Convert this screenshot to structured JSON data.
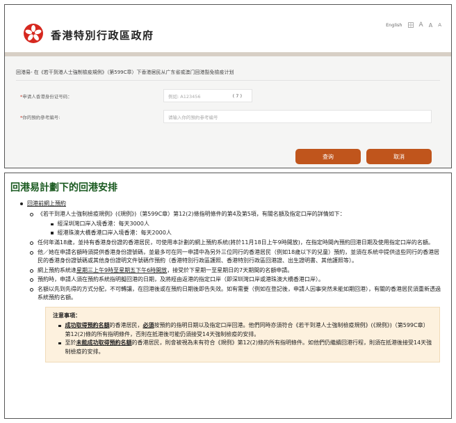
{
  "header": {
    "gov_title": "香港特別行政區政府",
    "lang_link": "English",
    "font_sizes": [
      "A",
      "A",
      "A"
    ]
  },
  "scheme": {
    "title": "回港易- 在《若干到港人士強制檢疫規例》（第599C章）下香港居民从广东省或澳门回港豁免檢疫计划"
  },
  "form": {
    "id_label": "申请人香港身份证号码：",
    "id_placeholder": "例如: A123456",
    "check_digit_placeholder": "( 7 )",
    "ref_label": "你的預約參考編号:",
    "ref_placeholder": "请输入你的預約参考编号",
    "required_mark": "*",
    "search_button": "查询",
    "cancel_button": "取消"
  },
  "arrangement": {
    "heading": "回港易計劃下的回港安排",
    "section_label": "回港前網上預約",
    "intro": "《若干到港人士強制檢疫規例》(《規例》)（第599C章）第12(2)條指明條件的第4及第5項，有關名額及指定口岸的詳情如下：",
    "quotas": [
      "經深圳灣口岸入境香港：每天3000人",
      "經港珠澳大橋香港口岸入境香港：每天2000人"
    ],
    "items": [
      "任何年滿18歲，並持有香港身份證的香港居民，可使用本計劃的網上預約系統(將於11月18日上午9時開放)，在指定時間內預約回港日期及使用指定口岸的名額。",
      "他／她在申請名額時須提供香港身份證號碼，並最多可在同一申請中為另外三位同行的香港居民（例如18歲以下的兒童）預約，並須在系統中提供這些同行的香港居民的香港身份證號碼或其他身份證明文件號碼作預約（香港特別行政區護照、香港特別行政區回港證、出生證明書、其他護照等）。"
    ],
    "schedule_prefix": "網上預約系統逢",
    "schedule_time": "星期三上午9時至星期五下午6時開放",
    "schedule_suffix": "，接受於下星期一至星期日的7天期間的名額申請。",
    "item_port": "預約時，申請人須在預約系統指明擬回港的日期，及將經由返港的指定口岸（即深圳灣口岸或港珠澳大橋香港口岸）。",
    "item_quota": "名額以先到先得的方式分配，不可轉讓，在回港後或在預約日期後即告失效。如有需要（例如在登記後，申請人因事突然未能如期回港），有關的香港居民須重新透過系統預約名額。"
  },
  "notice": {
    "title": "注意事項：",
    "item1_bold1": "成功取得預約名額",
    "item1_mid": "的香港居民，",
    "item1_bold2": "必須",
    "item1_rest": "按預約的指明日期以及指定口岸回港。他們同時亦須符合《若干到港人士強制檢疫規例》(《規例》)（第599C章）第12(2)條的所有指明條件，否則在抵港後可能仍須接受14天強制檢疫的安排。",
    "item2_prefix": "至於",
    "item2_bold": "未能成功取得預約名額",
    "item2_rest": "的香港居民，則會被視為未有符合《規例》第12(2)條的所有指明條件。如他們仍繼續回港行程，則須在抵港後接受14天強制檢疫的安排。"
  }
}
